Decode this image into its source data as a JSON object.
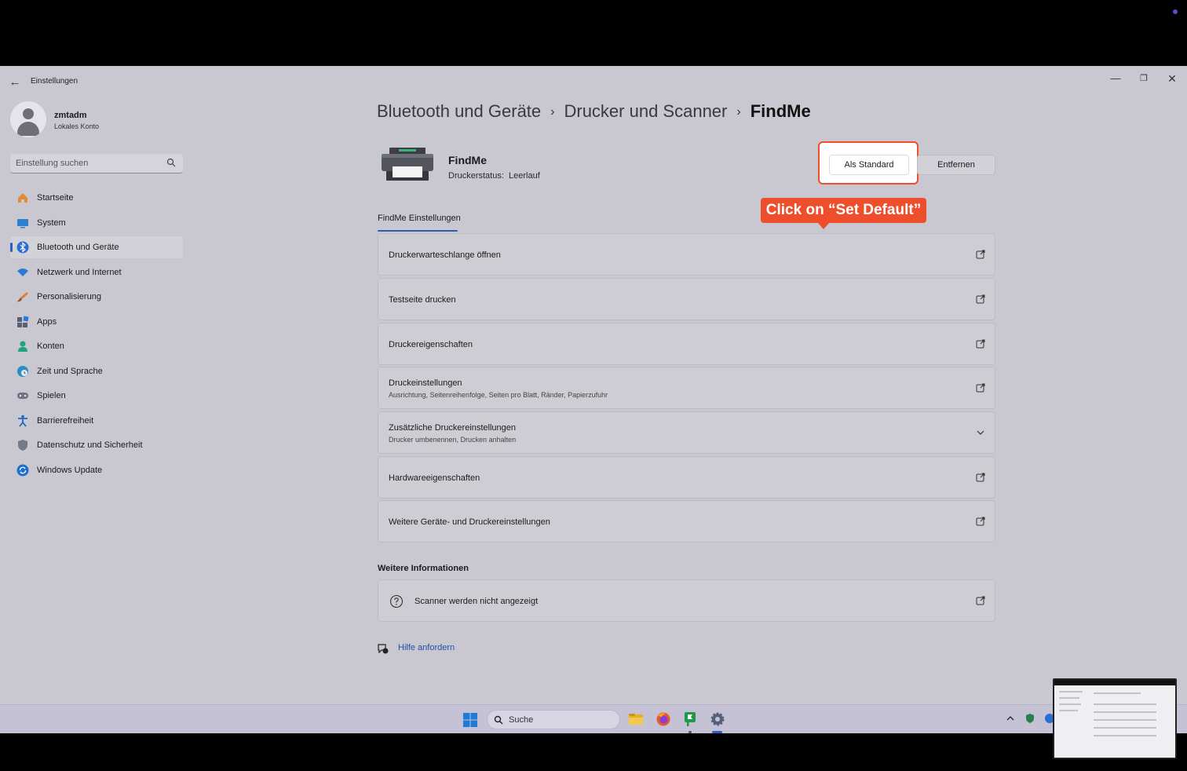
{
  "app": {
    "title": "Einstellungen",
    "back_icon": "back-arrow-icon"
  },
  "profile": {
    "name": "zmtadm",
    "account_type": "Lokales Konto"
  },
  "search": {
    "placeholder": "Einstellung suchen"
  },
  "sidebar": {
    "items": [
      {
        "label": "Startseite",
        "icon": "home-icon"
      },
      {
        "label": "System",
        "icon": "monitor-icon"
      },
      {
        "label": "Bluetooth und Geräte",
        "icon": "bluetooth-icon",
        "active": true
      },
      {
        "label": "Netzwerk und Internet",
        "icon": "wifi-icon"
      },
      {
        "label": "Personalisierung",
        "icon": "brush-icon"
      },
      {
        "label": "Apps",
        "icon": "apps-icon"
      },
      {
        "label": "Konten",
        "icon": "person-icon"
      },
      {
        "label": "Zeit und Sprache",
        "icon": "globe-clock-icon"
      },
      {
        "label": "Spielen",
        "icon": "gamepad-icon"
      },
      {
        "label": "Barrierefreiheit",
        "icon": "accessibility-icon"
      },
      {
        "label": "Datenschutz und Sicherheit",
        "icon": "shield-icon"
      },
      {
        "label": "Windows Update",
        "icon": "update-icon"
      }
    ]
  },
  "breadcrumb": {
    "level1": "Bluetooth und Geräte",
    "level2": "Drucker und Scanner",
    "current": "FindMe",
    "separator": "›"
  },
  "printer": {
    "name": "FindMe",
    "status_label": "Druckerstatus:",
    "status_value": "Leerlauf",
    "set_default_label": "Als Standard",
    "remove_label": "Entfernen"
  },
  "annotation": {
    "tooltip": "Click on “Set Default”",
    "color": "#ee4e2c"
  },
  "tab": {
    "label": "FindMe Einstellungen"
  },
  "settings": [
    {
      "title": "Druckerwarteschlange öffnen",
      "subtitle": "",
      "action": "external-link-icon"
    },
    {
      "title": "Testseite drucken",
      "subtitle": "",
      "action": "external-link-icon"
    },
    {
      "title": "Druckereigenschaften",
      "subtitle": "",
      "action": "external-link-icon"
    },
    {
      "title": "Druckeinstellungen",
      "subtitle": "Ausrichtung, Seitenreihenfolge, Seiten pro Blatt, Ränder, Papierzufuhr",
      "action": "external-link-icon"
    },
    {
      "title": "Zusätzliche Druckereinstellungen",
      "subtitle": "Drucker umbenennen, Drucken anhalten",
      "action": "chevron-down-icon"
    },
    {
      "title": "Hardwareeigenschaften",
      "subtitle": "",
      "action": "external-link-icon"
    },
    {
      "title": "Weitere Geräte- und Druckereinstellungen",
      "subtitle": "",
      "action": "external-link-icon"
    }
  ],
  "more_info": {
    "heading": "Weitere Informationen",
    "item": "Scanner werden nicht angezeigt"
  },
  "help": {
    "label": "Hilfe anfordern"
  },
  "taskbar": {
    "search_label": "Suche",
    "apps": [
      "file-explorer-icon",
      "firefox-icon",
      "green-flag-app-icon",
      "settings-gear-icon"
    ]
  },
  "colors": {
    "accent": "#2a5ebd",
    "window_bg": "#c9c7cf",
    "annotation": "#ee4e2c"
  }
}
